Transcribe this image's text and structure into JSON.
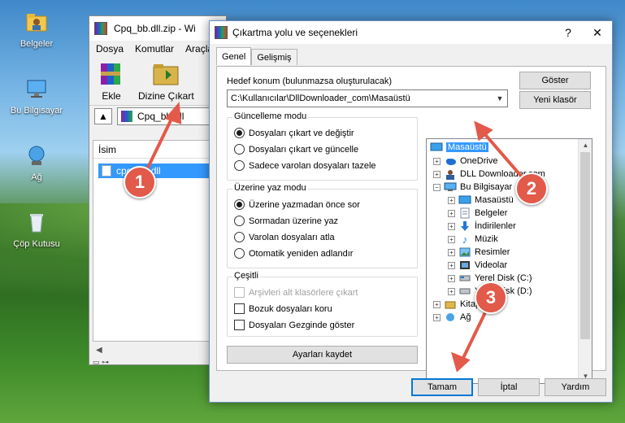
{
  "desktop": {
    "icons": [
      {
        "label": "Belgeler",
        "icon": "folder-user-icon"
      },
      {
        "label": "Bu Bilgisayar",
        "icon": "computer-icon"
      },
      {
        "label": "Ağ",
        "icon": "network-icon"
      },
      {
        "label": "Çöp Kutusu",
        "icon": "recycle-bin-icon"
      }
    ]
  },
  "rar_window": {
    "title": "Cpq_bb.dll.zip - Wi",
    "menu": [
      "Dosya",
      "Komutlar",
      "Araçla"
    ],
    "toolbar": {
      "add_label": "Ekle",
      "extract_label": "Dizine Çıkart"
    },
    "path": "Cpq_bb.dll",
    "column_name": "İsim",
    "file": "cpq_bb.dll"
  },
  "dialog": {
    "title": "Çıkartma yolu ve seçenekleri",
    "help_glyph": "?",
    "close_glyph": "✕",
    "tabs": [
      "Genel",
      "Gelişmiş"
    ],
    "destination_label": "Hedef konum (bulunmazsa oluşturulacak)",
    "destination_value": "C:\\Kullanıcılar\\DllDownloader_com\\Masaüstü",
    "show_button": "Göster",
    "new_folder_button": "Yeni klasör",
    "update_mode": {
      "title": "Güncelleme modu",
      "options": [
        "Dosyaları çıkart ve değiştir",
        "Dosyaları çıkart ve güncelle",
        "Sadece varolan dosyaları tazele"
      ],
      "selected": 0
    },
    "overwrite_mode": {
      "title": "Üzerine yaz modu",
      "options": [
        "Üzerine yazmadan önce sor",
        "Sormadan üzerine yaz",
        "Varolan dosyaları atla",
        "Otomatik yeniden adlandır"
      ],
      "selected": 0
    },
    "misc": {
      "title": "Çeşitli",
      "options": [
        {
          "label": "Arşivleri alt klasörlere çıkart",
          "checked": false,
          "disabled": true
        },
        {
          "label": "Bozuk dosyaları koru",
          "checked": false,
          "disabled": false
        },
        {
          "label": "Dosyaları Gezginde göster",
          "checked": false,
          "disabled": false
        }
      ]
    },
    "save_settings_button": "Ayarları kaydet",
    "tree": [
      {
        "label": "Masaüstü",
        "icon": "desktop-icon",
        "level": 0,
        "expander": "",
        "selected": true
      },
      {
        "label": "OneDrive",
        "icon": "cloud-icon",
        "level": 1,
        "expander": "+"
      },
      {
        "label": "DLL Downloader.com",
        "icon": "user-icon",
        "level": 1,
        "expander": "+"
      },
      {
        "label": "Bu Bilgisayar",
        "icon": "computer-icon",
        "level": 1,
        "expander": "−"
      },
      {
        "label": "Masaüstü",
        "icon": "desktop-icon",
        "level": 2,
        "expander": "+"
      },
      {
        "label": "Belgeler",
        "icon": "documents-icon",
        "level": 2,
        "expander": "+"
      },
      {
        "label": "İndirilenler",
        "icon": "download-icon",
        "level": 2,
        "expander": "+"
      },
      {
        "label": "Müzik",
        "icon": "music-icon",
        "level": 2,
        "expander": "+"
      },
      {
        "label": "Resimler",
        "icon": "pictures-icon",
        "level": 2,
        "expander": "+"
      },
      {
        "label": "Videolar",
        "icon": "videos-icon",
        "level": 2,
        "expander": "+"
      },
      {
        "label": "Yerel Disk (C:)",
        "icon": "drive-icon",
        "level": 2,
        "expander": "+"
      },
      {
        "label": "Yerel Disk (D:)",
        "icon": "drive-icon",
        "level": 2,
        "expander": "+"
      },
      {
        "label": "Kitaplıklar",
        "icon": "libraries-icon",
        "level": 1,
        "expander": "+"
      },
      {
        "label": "Ağ",
        "icon": "network-icon",
        "level": 1,
        "expander": "+"
      }
    ],
    "ok_button": "Tamam",
    "cancel_button": "İptal",
    "help_button": "Yardım"
  },
  "markers": [
    "1",
    "2",
    "3"
  ],
  "colors": {
    "marker": "#e25a4a",
    "selection": "#3399ff",
    "default_button_border": "#0078d7"
  }
}
